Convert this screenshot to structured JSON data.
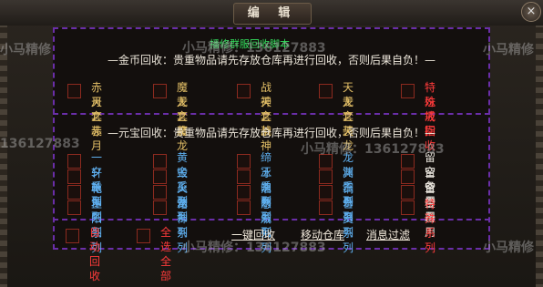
{
  "window": {
    "title": "编 辑",
    "close_glyph": "×"
  },
  "top_note": "播修群服回收脚本",
  "watermarks": [
    "小马精修",
    "136127883",
    "小马精修：136127883",
    "小马精修：136127883",
    "小马精修：136127883",
    "小马精修",
    "小马精修"
  ],
  "gold_section": {
    "notice": "—金币回收：贵重物品请先存放仓库再进行回收，否则后果自负！—",
    "columns": [
      {
        "line1": "赤月套装",
        "line2": "天之赤月",
        "color": "#e4c067"
      },
      {
        "line1": "魔龙套装",
        "line2": "天之魔龙",
        "color": "#e4c067"
      },
      {
        "line1": "战神套装",
        "line2": "天之战神",
        "color": "#e4c067"
      },
      {
        "line1": "天龙套装",
        "line2": "天之天龙",
        "color": "#e4c067"
      },
      {
        "line1": "特殊戒指",
        "line2": "垃圾回收",
        "color": "#ff3b3b"
      }
    ]
  },
  "yuanbao_section": {
    "notice": "—元宝回收：贵重物品请先存放仓库再进行回收，否则后果自负！—",
    "columns": [
      [
        "一夕系列",
        "轩辕系列",
        "乾坤系列",
        "正阳系列"
      ],
      [
        "黄金系列",
        "毁灭系列",
        "火龙系列",
        "诸神系列"
      ],
      [
        "缔王系列",
        "冰魄系列",
        "泪雨系列",
        "悲戚系列"
      ],
      [
        "龙渊系列",
        "冥王系列",
        "铜骨系列",
        "亡灵系列"
      ],
      [
        "留空备用",
        "留空备用",
        "留空备用",
        "特殊系列"
      ]
    ]
  },
  "footer": {
    "auto_recycle": "自动回收",
    "select_all": "全选全部",
    "one_click": "一键回收",
    "move_storage": "移动仓库",
    "message_filter": "消息过滤"
  }
}
